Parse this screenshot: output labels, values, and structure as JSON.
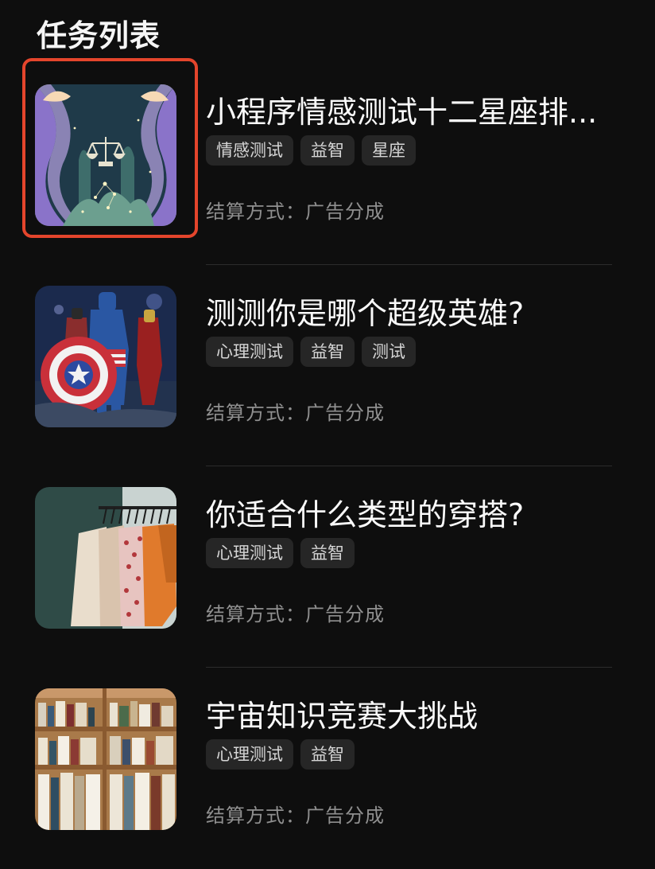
{
  "page": {
    "title": "任务列表"
  },
  "settlement_label": "结算方式：广告分成",
  "accent": {
    "highlight": "#e4452c",
    "background": "#0e0e0e",
    "tag_bg": "#262626"
  },
  "tasks": [
    {
      "title": "小程序情感测试十二星座排...",
      "tags": [
        "情感测试",
        "益智",
        "星座"
      ],
      "settlement": "结算方式：广告分成",
      "image": "zodiac-libra-art"
    },
    {
      "title": "测测你是哪个超级英雄?",
      "tags": [
        "心理测试",
        "益智",
        "测试"
      ],
      "settlement": "结算方式：广告分成",
      "image": "superhero-figures"
    },
    {
      "title": "你适合什么类型的穿搭?",
      "tags": [
        "心理测试",
        "益智"
      ],
      "settlement": "结算方式：广告分成",
      "image": "clothing-rack"
    },
    {
      "title": "宇宙知识竞赛大挑战",
      "tags": [
        "心理测试",
        "益智"
      ],
      "settlement": "结算方式：广告分成",
      "image": "bookshelf"
    }
  ]
}
